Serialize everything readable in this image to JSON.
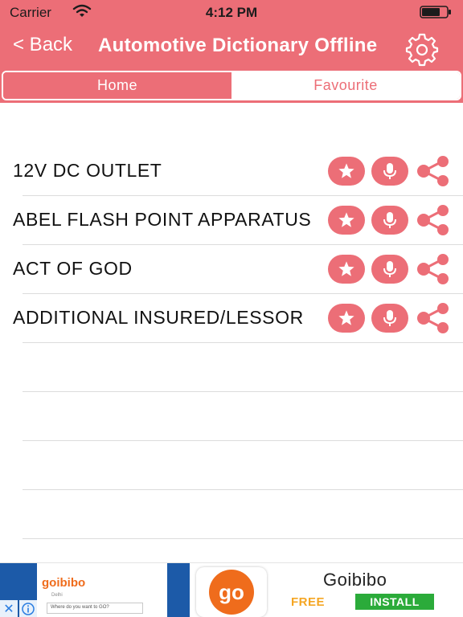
{
  "status_bar": {
    "carrier": "Carrier",
    "time": "4:12 PM"
  },
  "nav": {
    "back_label": "< Back",
    "title": "Automotive Dictionary Offline",
    "settings_icon": "gear-icon"
  },
  "tabs": [
    {
      "label": "Home",
      "selected": true
    },
    {
      "label": "Favourite",
      "selected": false
    }
  ],
  "words": [
    {
      "label": "12V DC OUTLET"
    },
    {
      "label": "ABEL FLASH POINT APPARATUS"
    },
    {
      "label": "ACT OF GOD"
    },
    {
      "label": "ADDITIONAL INSURED/LESSOR"
    }
  ],
  "row_icons": [
    "star-icon",
    "microphone-icon",
    "share-icon"
  ],
  "ad": {
    "brand_small": "goibibo",
    "city": "Delhi",
    "search_placeholder": "Where do you want to GO?",
    "logo_text": "go",
    "app_name": "Goibibo",
    "price": "FREE",
    "install_label": "INSTALL"
  },
  "colors": {
    "accent": "#ec6e77",
    "ad_orange": "#ef6c1c",
    "install_green": "#2bab3a"
  }
}
